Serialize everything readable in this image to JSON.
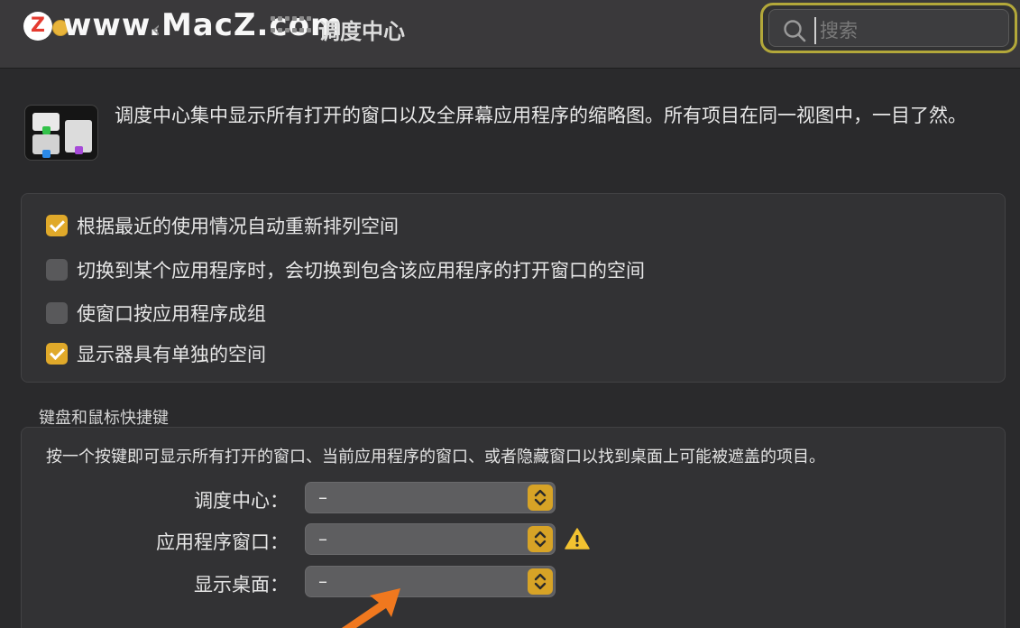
{
  "titlebar": {
    "title": "调度中心",
    "watermark_badge": "Z",
    "watermark_text": "www.MacZ.com",
    "back_glyph": "‹"
  },
  "search": {
    "placeholder": "搜索",
    "value": ""
  },
  "app": {
    "icon": "mission-control-icon",
    "description": "调度中心集中显示所有打开的窗口以及全屏幕应用程序的缩略图。所有项目在同一视图中，一目了然。"
  },
  "options": [
    {
      "label": "根据最近的使用情况自动重新排列空间",
      "checked": true
    },
    {
      "label": "切换到某个应用程序时，会切换到包含该应用程序的打开窗口的空间",
      "checked": false
    },
    {
      "label": "使窗口按应用程序成组",
      "checked": false
    },
    {
      "label": "显示器具有单独的空间",
      "checked": true
    }
  ],
  "shortcuts": {
    "section_title": "键盘和鼠标快捷键",
    "description": "按一个按键即可显示所有打开的窗口、当前应用程序的窗口、或者隐藏窗口以找到桌面上可能被遮盖的项目。",
    "rows": [
      {
        "label": "调度中心：",
        "value": "–",
        "warning": false
      },
      {
        "label": "应用程序窗口：",
        "value": "–",
        "warning": true
      },
      {
        "label": "显示桌面：",
        "value": "–",
        "warning": false
      }
    ]
  },
  "colors": {
    "accent": "#e0a92a",
    "search_highlight": "#b3a83a",
    "annotation_arrow": "#f0781e",
    "background": "#2a2a2c"
  }
}
